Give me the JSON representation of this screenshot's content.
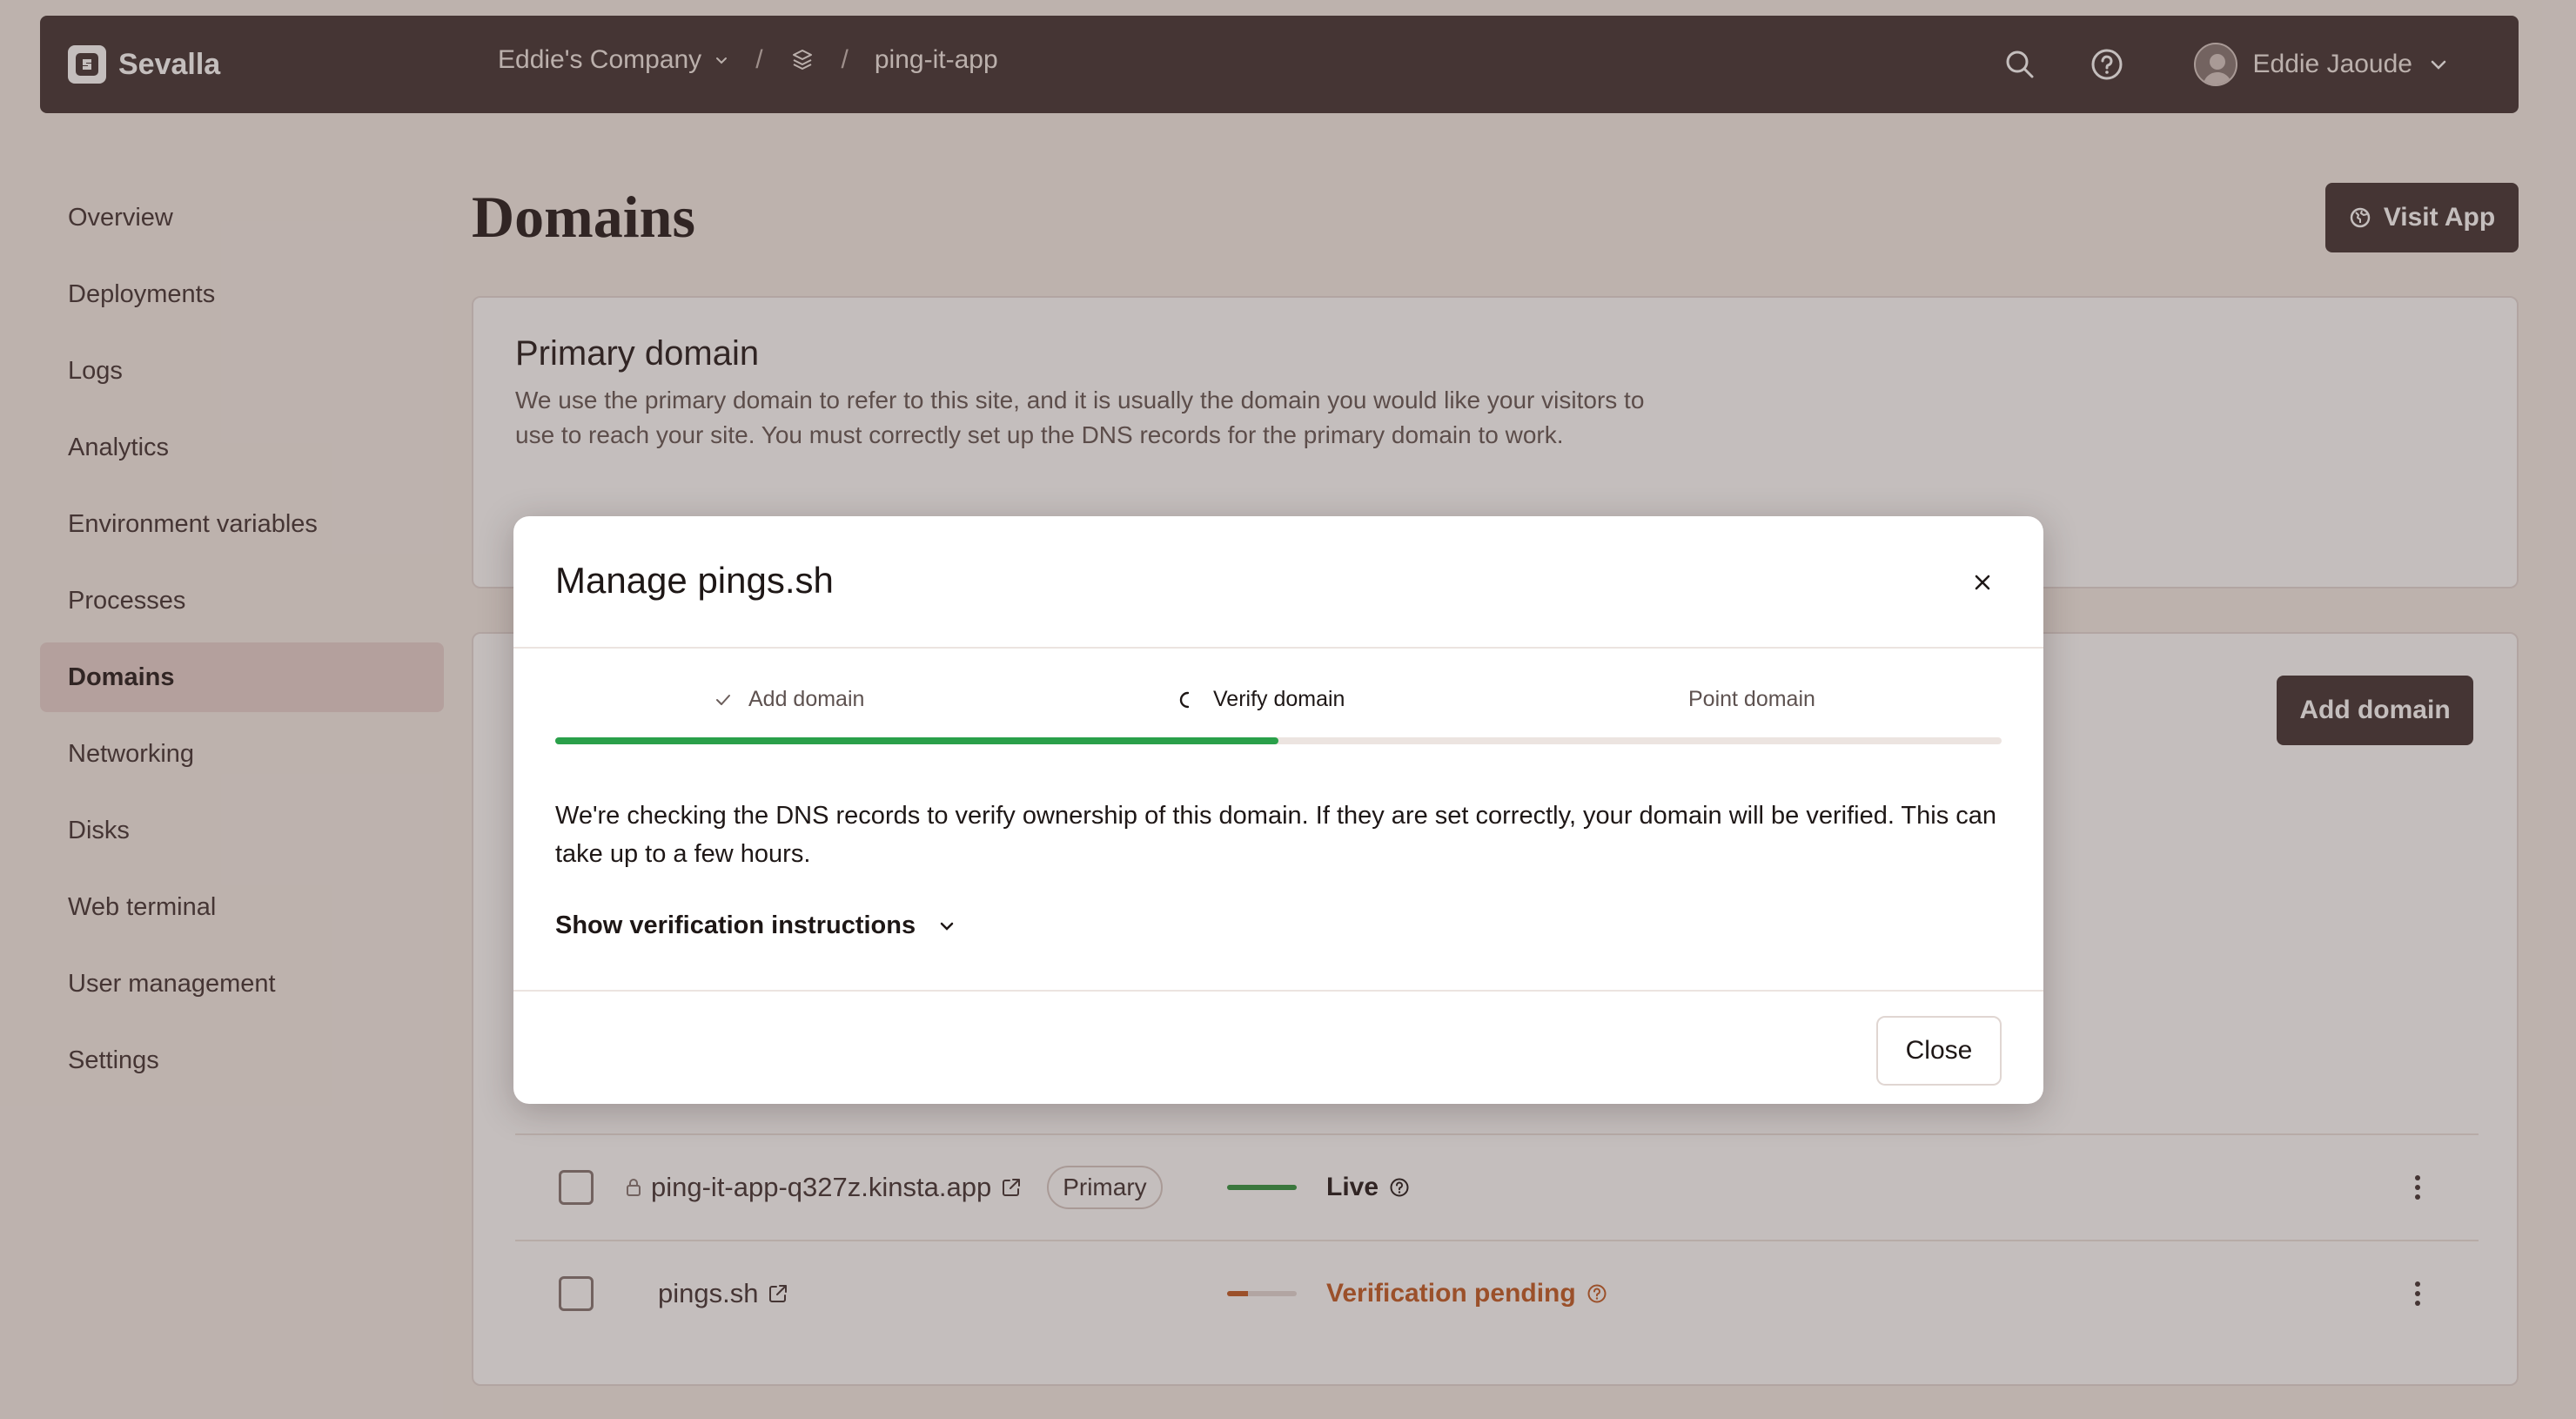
{
  "colors": {
    "topbar": "#4a3c3b",
    "accent_green": "#2aa04a",
    "pending_orange": "#c4622d",
    "live_green": "#3a9a48"
  },
  "topbar": {
    "brand": "Sevalla",
    "company": "Eddie's Company",
    "app": "ping-it-app",
    "user": "Eddie Jaoude",
    "icons": [
      "search-icon",
      "help-icon",
      "chevron-down-icon",
      "stack-icon"
    ]
  },
  "sidebar": {
    "items": [
      {
        "label": "Overview"
      },
      {
        "label": "Deployments"
      },
      {
        "label": "Logs"
      },
      {
        "label": "Analytics"
      },
      {
        "label": "Environment variables"
      },
      {
        "label": "Processes"
      },
      {
        "label": "Domains",
        "active": true
      },
      {
        "label": "Networking"
      },
      {
        "label": "Disks"
      },
      {
        "label": "Web terminal"
      },
      {
        "label": "User management"
      },
      {
        "label": "Settings"
      }
    ]
  },
  "main": {
    "title": "Domains",
    "visit_app": "Visit App",
    "primary_card": {
      "title": "Primary domain",
      "description": "We use the primary domain to refer to this site, and it is usually the domain you would like your visitors to use to reach your site. You must correctly set up the DNS records for the primary domain to work."
    },
    "add_domain": "Add domain",
    "domains": [
      {
        "name": "ping-it-app-q327z.kinsta.app",
        "badge": "Primary",
        "status": "Live",
        "progress": 1.0
      },
      {
        "name": "pings.sh",
        "status": "Verification pending",
        "progress": 0.3
      }
    ]
  },
  "modal": {
    "title": "Manage pings.sh",
    "steps": [
      {
        "label": "Add domain",
        "state": "done"
      },
      {
        "label": "Verify domain",
        "state": "current"
      },
      {
        "label": "Point domain",
        "state": "upcoming"
      }
    ],
    "progress": 0.5,
    "body": "We're checking the DNS records to verify ownership of this domain. If they are set correctly, your domain will be verified. This can take up to a few hours.",
    "toggle": "Show verification instructions",
    "close": "Close"
  }
}
